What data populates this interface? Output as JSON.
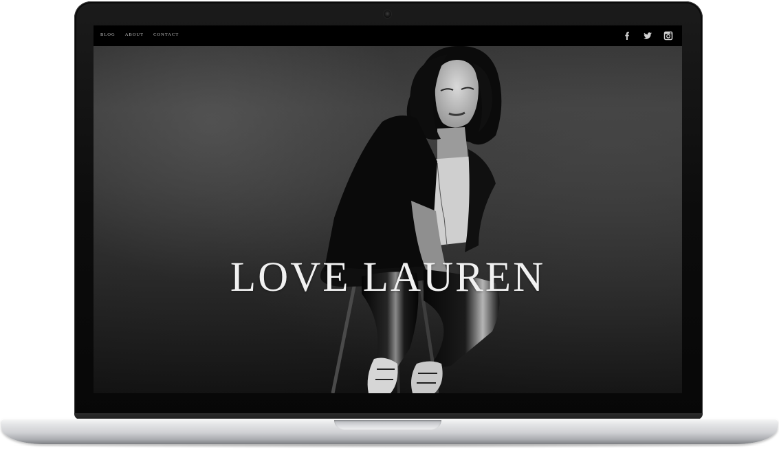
{
  "site": {
    "nav": {
      "blog": "BLOG",
      "about": "ABOUT",
      "contact": "CONTACT"
    },
    "social": [
      "facebook-icon",
      "twitter-icon",
      "instagram-icon"
    ],
    "hero": {
      "title": "LOVE LAUREN"
    }
  },
  "colors": {
    "topbar": "#000000",
    "nav_text": "#c9c9c9",
    "title_text": "#f1f1f1",
    "backdrop": "#333333"
  }
}
